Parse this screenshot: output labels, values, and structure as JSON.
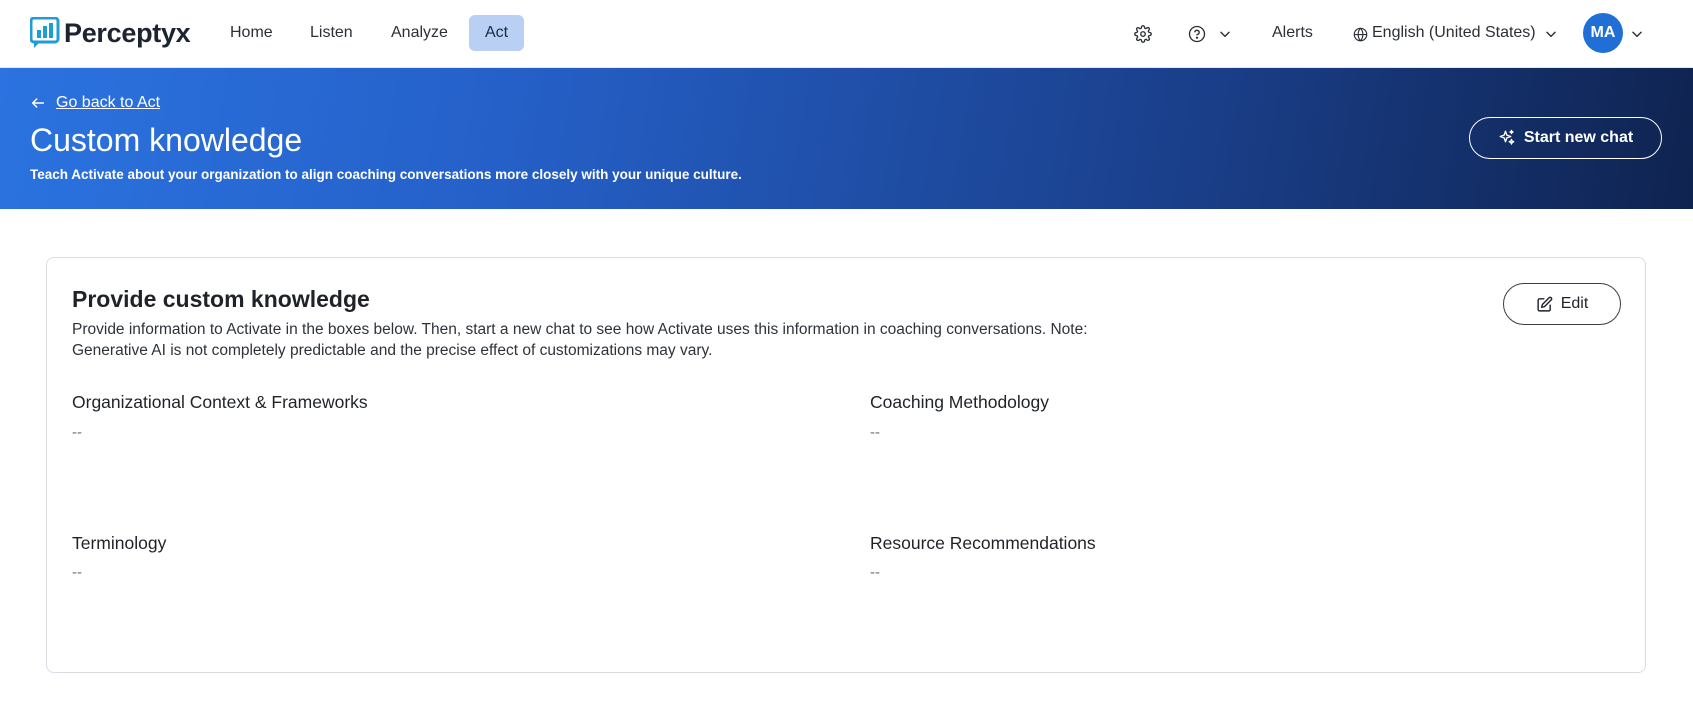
{
  "brand": {
    "name": "Perceptyx"
  },
  "nav": {
    "items": [
      {
        "label": "Home"
      },
      {
        "label": "Listen"
      },
      {
        "label": "Analyze"
      },
      {
        "label": "Act"
      }
    ],
    "active": "Act",
    "alerts_label": "Alerts",
    "language_label": "English (United States)",
    "avatar_initials": "MA"
  },
  "hero": {
    "back_label": "Go back to Act",
    "title": "Custom knowledge",
    "subtitle": "Teach Activate about your organization to align coaching conversations more closely with your unique culture.",
    "start_chat_label": "Start new chat"
  },
  "card": {
    "title": "Provide custom knowledge",
    "description": "Provide information to Activate in the boxes below. Then, start a new chat to see how Activate uses this information in coaching conversations. Note: Generative AI is not completely predictable and the precise effect of customizations may vary.",
    "edit_label": "Edit",
    "fields": [
      {
        "label": "Organizational Context & Frameworks",
        "value": "--"
      },
      {
        "label": "Coaching Methodology",
        "value": "--"
      },
      {
        "label": "Terminology",
        "value": "--"
      },
      {
        "label": "Resource Recommendations",
        "value": "--"
      }
    ]
  },
  "colors": {
    "accent": "#2b73e0",
    "nav_active_bg": "#b9cff3",
    "avatar_bg": "#1f6fd6",
    "hero_dark": "#0f2350"
  },
  "icons": {
    "settings": "gear-icon",
    "help": "help-circle-icon",
    "language": "globe-icon",
    "back": "arrow-left-icon",
    "chat": "sparkles-icon",
    "edit": "pencil-square-icon"
  }
}
